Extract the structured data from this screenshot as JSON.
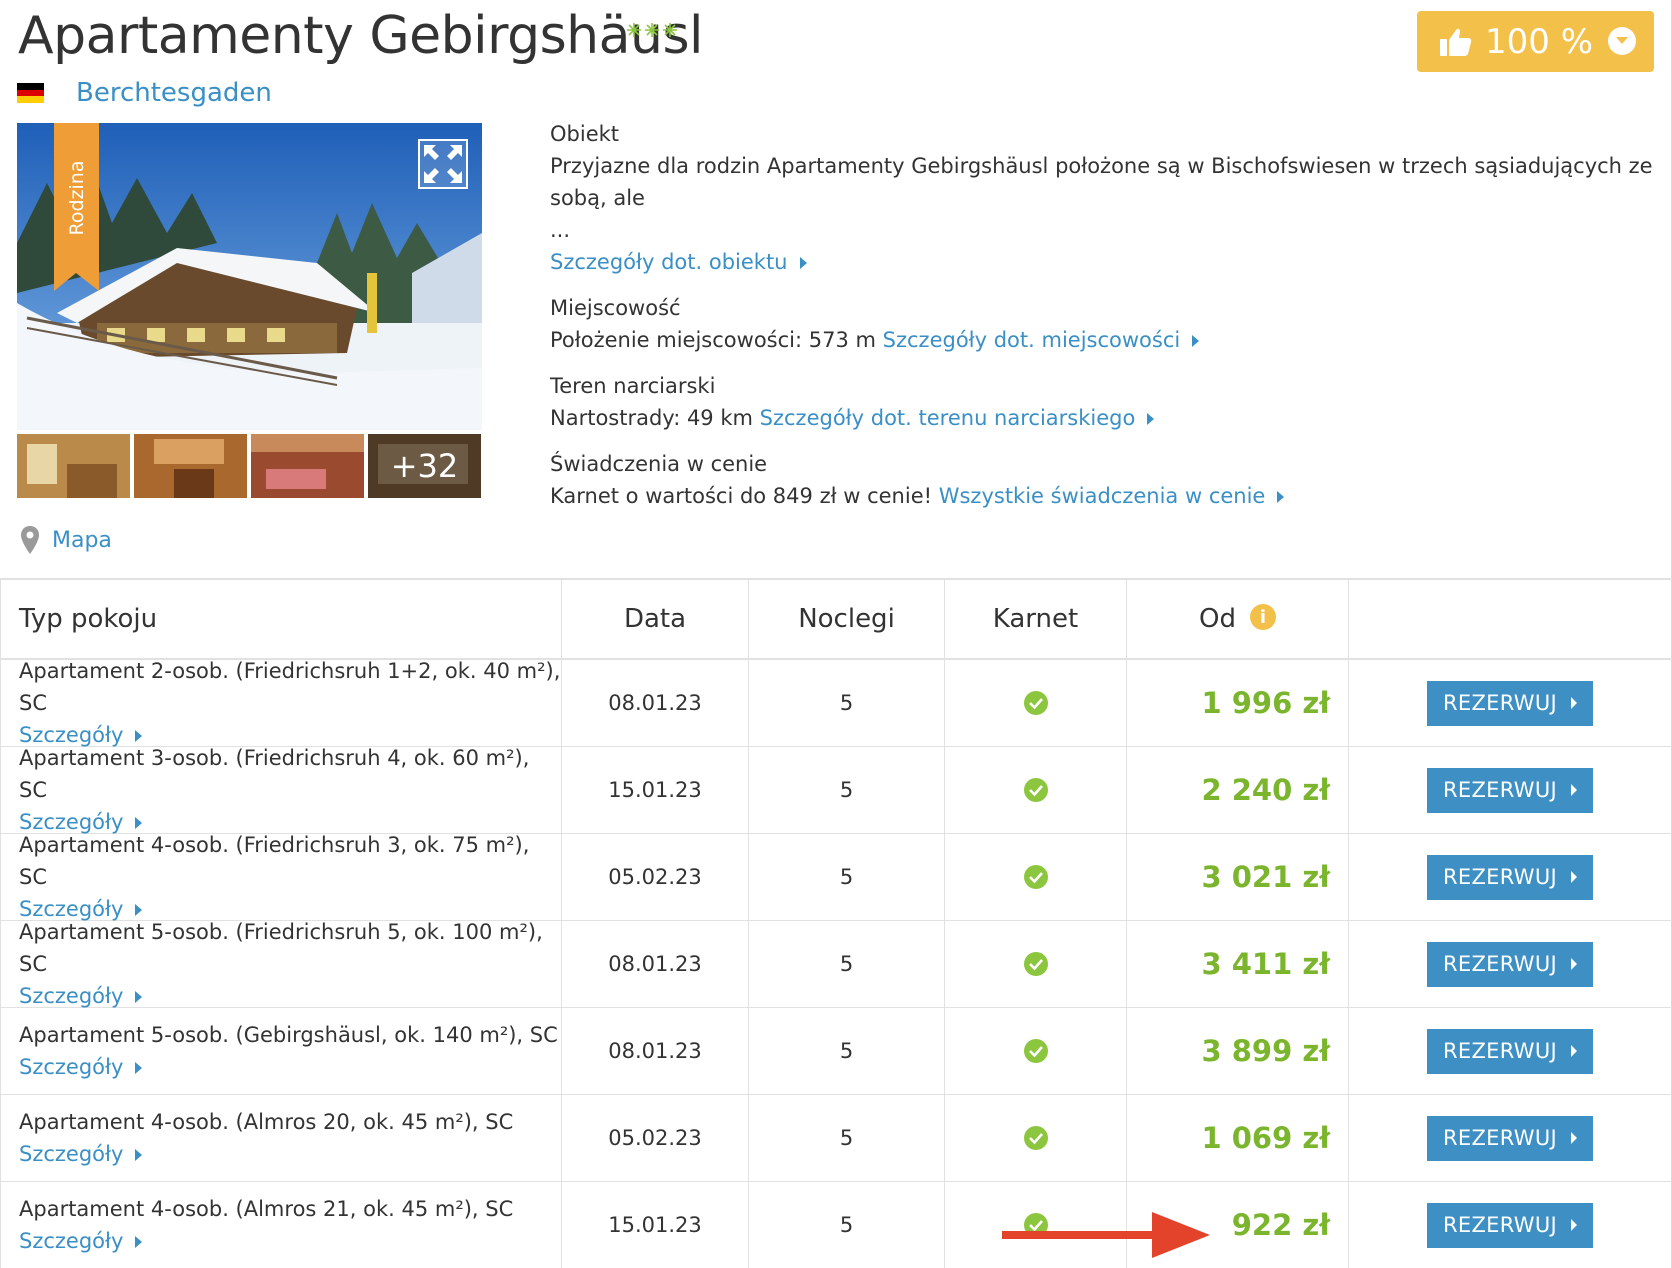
{
  "hotel": {
    "title": "Apartamenty Gebirgshäusl",
    "stars": 3,
    "rating_label": "100 %",
    "location": "Berchtesgaden",
    "badge": "Rodzina",
    "more_photos": "+32",
    "map_label": "Mapa"
  },
  "info": {
    "object_heading": "Obiekt",
    "object_text": "Przyjazne dla rodzin Apartamenty Gebirgshäusl położone są w Bischofswiesen w trzech sąsiadujących ze sobą, ale",
    "object_ellipsis": "...",
    "object_link": "Szczegóły dot. obiektu",
    "town_heading": "Miejscowość",
    "town_text": "Położenie miejscowości: 573 m",
    "town_link": "Szczegóły dot. miejscowości",
    "ski_heading": "Teren narciarski",
    "ski_text": "Nartostrady: 49 km",
    "ski_link": "Szczegóły dot. terenu narciarskiego",
    "incl_heading": "Świadczenia w cenie",
    "incl_text": "Karnet o wartości do 849 zł w cenie!",
    "incl_link": "Wszystkie świadczenia w cenie"
  },
  "table": {
    "headers": {
      "room": "Typ pokoju",
      "date": "Data",
      "nights": "Noclegi",
      "pass": "Karnet",
      "from": "Od",
      "from_info": "i"
    },
    "details_label": "Szczegóły",
    "book_label": "REZERWUJ",
    "rows": [
      {
        "room": "Apartament 2-osob. (Friedrichsruh 1+2, ok. 40 m²), SC",
        "date": "08.01.23",
        "nights": "5",
        "price": "1 996 zł"
      },
      {
        "room": "Apartament 3-osob. (Friedrichsruh 4, ok. 60 m²), SC",
        "date": "15.01.23",
        "nights": "5",
        "price": "2 240 zł"
      },
      {
        "room": "Apartament 4-osob. (Friedrichsruh 3, ok. 75 m²), SC",
        "date": "05.02.23",
        "nights": "5",
        "price": "3 021 zł"
      },
      {
        "room": "Apartament 5-osob. (Friedrichsruh 5, ok. 100 m²), SC",
        "date": "08.01.23",
        "nights": "5",
        "price": "3 411 zł"
      },
      {
        "room": "Apartament 5-osob. (Gebirgshäusl, ok. 140 m²), SC",
        "date": "08.01.23",
        "nights": "5",
        "price": "3 899 zł"
      },
      {
        "room": "Apartament 4-osob. (Almros 20, ok. 45 m²), SC",
        "date": "05.02.23",
        "nights": "5",
        "price": "1 069 zł"
      },
      {
        "room": "Apartament 4-osob. (Almros 21, ok. 45 m²), SC",
        "date": "15.01.23",
        "nights": "5",
        "price": "922 zł"
      }
    ]
  },
  "colors": {
    "link": "#3a8fc6",
    "price": "#7ab52d",
    "rating": "#f3c04a",
    "badge": "#ee9d37",
    "button": "#3e8fc3",
    "annotation_arrow": "#e2432a"
  },
  "icons": {
    "rating": "thumbs-up-icon",
    "dropdown": "chevron-down-icon",
    "expand": "expand-icon",
    "map": "map-pin-icon",
    "included": "check-circle-icon",
    "info": "info-icon"
  }
}
